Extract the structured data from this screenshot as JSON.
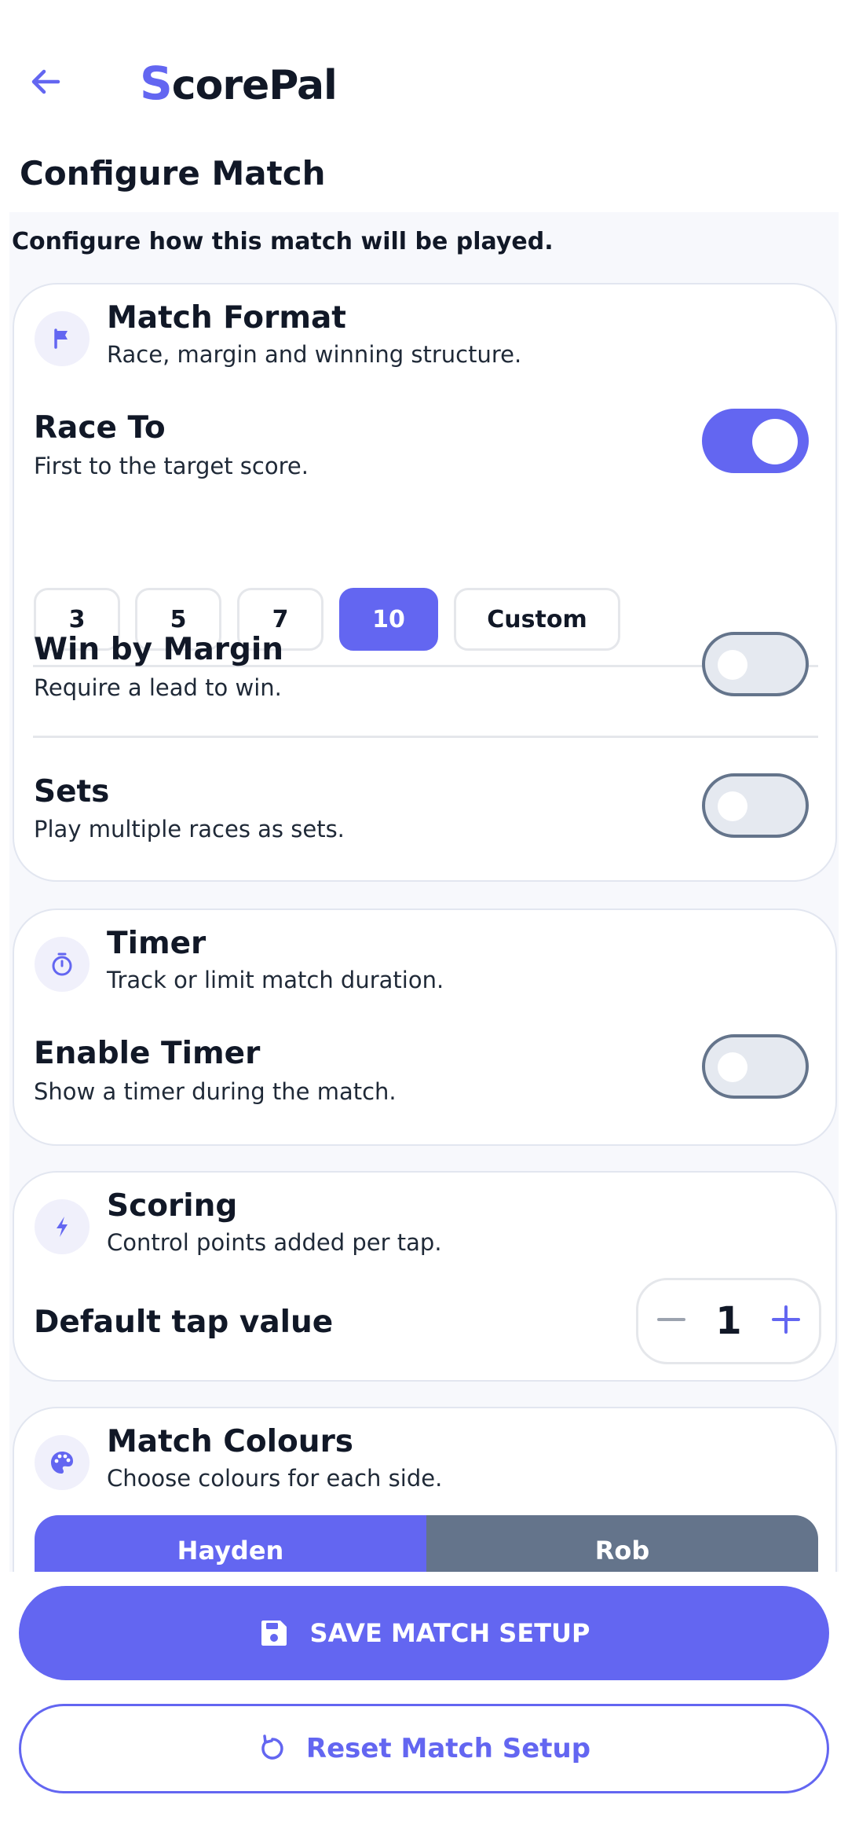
{
  "header": {
    "back_icon": "arrow-left-icon",
    "logo_initial": "S",
    "logo_rest": "corePal",
    "page_title": "Configure Match"
  },
  "intro": "Configure how this match will be played.",
  "match_format": {
    "icon": "flag-icon",
    "title": "Match Format",
    "subtitle": "Race, margin and winning structure.",
    "race_to": {
      "title": "Race To",
      "subtitle": "First to the target score.",
      "enabled": true,
      "options": [
        "3",
        "5",
        "7",
        "10",
        "Custom"
      ],
      "selected": "10"
    },
    "win_by_margin": {
      "title": "Win by Margin",
      "subtitle": "Require a lead to win.",
      "enabled": false
    },
    "sets": {
      "title": "Sets",
      "subtitle": "Play multiple races as sets.",
      "enabled": false
    }
  },
  "timer": {
    "icon": "stopwatch-icon",
    "title": "Timer",
    "subtitle": "Track or limit match duration.",
    "enable_timer": {
      "title": "Enable Timer",
      "subtitle": "Show a timer during the match.",
      "enabled": false
    }
  },
  "scoring": {
    "icon": "lightning-icon",
    "title": "Scoring",
    "subtitle": "Control points added per tap.",
    "default_tap": {
      "label": "Default tap value",
      "value": "1"
    }
  },
  "match_colours": {
    "icon": "palette-icon",
    "title": "Match Colours",
    "subtitle": "Choose colours for each side.",
    "sides": [
      {
        "name": "Hayden",
        "color": "#6366f1"
      },
      {
        "name": "Rob",
        "color": "#64748b"
      }
    ]
  },
  "footer": {
    "save_label": "SAVE MATCH SETUP",
    "save_icon": "floppy-disk-icon",
    "reset_label": "Reset Match Setup",
    "reset_icon": "reset-icon"
  },
  "colors": {
    "accent": "#6366f1",
    "toggle_off_border": "#64748b",
    "text": "#111827"
  }
}
